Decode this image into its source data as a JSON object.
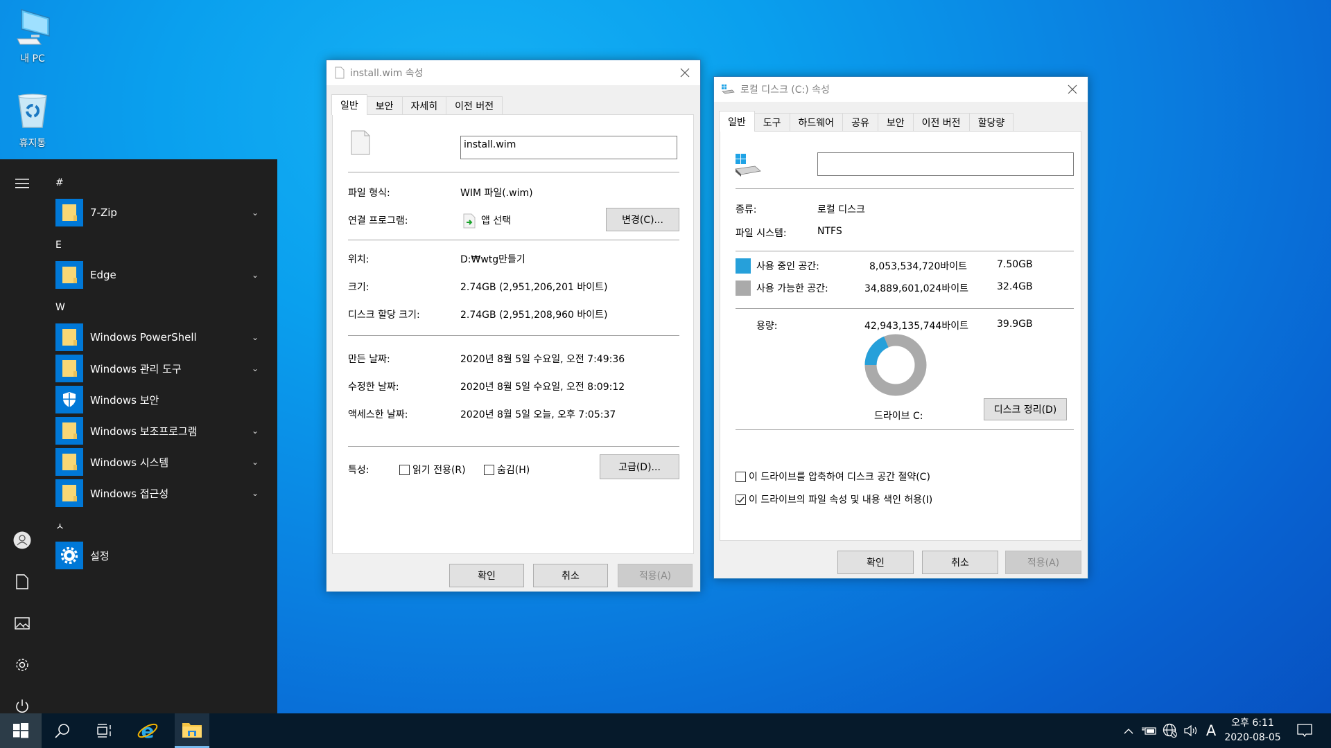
{
  "desktop": {
    "icons": [
      {
        "label": "내 PC",
        "icon": "computer-icon"
      },
      {
        "label": "휴지통",
        "icon": "recycle-bin-icon"
      }
    ]
  },
  "start_menu": {
    "rail": [
      "hamburger-icon",
      "user-icon",
      "documents-icon",
      "pictures-icon",
      "settings-icon",
      "power-icon"
    ],
    "groups": [
      {
        "header": "#",
        "items": [
          {
            "label": "7-Zip",
            "icon": "folder-icon",
            "expandable": true
          }
        ]
      },
      {
        "header": "E",
        "items": [
          {
            "label": "Edge",
            "icon": "folder-icon",
            "expandable": true
          }
        ]
      },
      {
        "header": "W",
        "items": [
          {
            "label": "Windows PowerShell",
            "icon": "folder-icon",
            "expandable": true
          },
          {
            "label": "Windows 관리 도구",
            "icon": "folder-icon",
            "expandable": true
          },
          {
            "label": "Windows 보안",
            "icon": "shield-icon",
            "expandable": false
          },
          {
            "label": "Windows 보조프로그램",
            "icon": "folder-icon",
            "expandable": true
          },
          {
            "label": "Windows 시스템",
            "icon": "folder-icon",
            "expandable": true
          },
          {
            "label": "Windows 접근성",
            "icon": "folder-icon",
            "expandable": true
          }
        ]
      },
      {
        "header": "ㅅ",
        "items": [
          {
            "label": "설정",
            "icon": "gear-icon",
            "expandable": false
          }
        ]
      }
    ]
  },
  "taskbar": {
    "pinned": [
      "start-icon",
      "search-icon",
      "task-view-icon",
      "internet-explorer-icon",
      "file-explorer-icon"
    ],
    "tray": {
      "ime": "A",
      "time": "오후 6:11",
      "date": "2020-08-05"
    }
  },
  "file_dialog": {
    "title": "install.wim 속성",
    "tabs": [
      "일반",
      "보안",
      "자세히",
      "이전 버전"
    ],
    "active_tab": "일반",
    "filename": "install.wim",
    "rows": {
      "type_label": "파일 형식:",
      "type_value": "WIM 파일(.wim)",
      "opens_label": "연결 프로그램:",
      "opens_value": "앱 선택",
      "change_button": "변경(C)...",
      "location_label": "위치:",
      "location_value": "D:₩wtg만들기",
      "size_label": "크기:",
      "size_value": "2.74GB (2,951,206,201 바이트)",
      "disk_size_label": "디스크 할당 크기:",
      "disk_size_value": "2.74GB (2,951,208,960 바이트)",
      "created_label": "만든 날짜:",
      "created_value": "2020년 8월 5일 수요일, 오전 7:49:36",
      "modified_label": "수정한 날짜:",
      "modified_value": "2020년 8월 5일 수요일, 오전 8:09:12",
      "accessed_label": "액세스한 날짜:",
      "accessed_value": "2020년 8월 5일 오늘, 오후 7:05:37",
      "attributes_label": "특성:",
      "readonly_label": "읽기 전용(R)",
      "readonly_checked": false,
      "hidden_label": "숨김(H)",
      "hidden_checked": false,
      "advanced_button": "고급(D)..."
    },
    "buttons": {
      "ok": "확인",
      "cancel": "취소",
      "apply": "적용(A)"
    }
  },
  "disk_dialog": {
    "title": "로컬 디스크 (C:) 속성",
    "tabs": [
      "일반",
      "도구",
      "하드웨어",
      "공유",
      "보안",
      "이전 버전",
      "할당량"
    ],
    "active_tab": "일반",
    "volume_label_value": "",
    "type_label": "종류:",
    "type_value": "로컬 디스크",
    "fs_label": "파일 시스템:",
    "fs_value": "NTFS",
    "used_label": "사용 중인 공간:",
    "used_bytes": "8,053,534,720바이트",
    "used_gb": "7.50GB",
    "free_label": "사용 가능한 공간:",
    "free_bytes": "34,889,601,024바이트",
    "free_gb": "32.4GB",
    "capacity_label": "용량:",
    "capacity_bytes": "42,943,135,744바이트",
    "capacity_gb": "39.9GB",
    "drive_label": "드라이브 C:",
    "cleanup_button": "디스크 정리(D)",
    "compress_label": "이 드라이브를 압축하여 디스크 공간 절약(C)",
    "compress_checked": false,
    "index_label": "이 드라이브의 파일 속성 및 내용 색인 허용(I)",
    "index_checked": true,
    "colors": {
      "used": "#26a0da",
      "free": "#aaaaaa"
    },
    "usage_fraction": 0.1875,
    "buttons": {
      "ok": "확인",
      "cancel": "취소",
      "apply": "적용(A)"
    }
  }
}
